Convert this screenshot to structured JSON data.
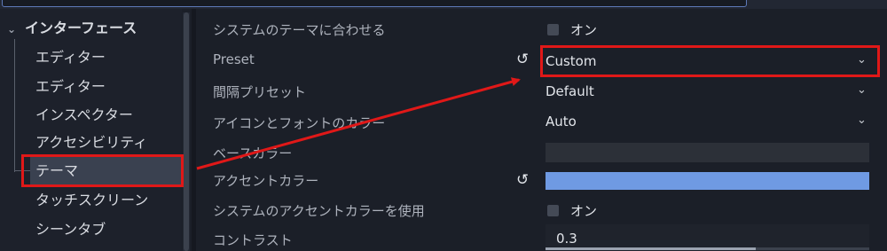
{
  "tree": {
    "root_label": "インターフェース",
    "items": [
      {
        "label": "エディター"
      },
      {
        "label": "エディター"
      },
      {
        "label": "インスペクター"
      },
      {
        "label": "アクセシビリティ"
      },
      {
        "label": "テーマ",
        "selected": true
      },
      {
        "label": "タッチスクリーン"
      },
      {
        "label": "シーンタブ"
      }
    ]
  },
  "inspector": {
    "follow_system_theme": {
      "label": "システムのテーマに合わせる",
      "value": "オン"
    },
    "preset": {
      "label": "Preset",
      "value": "Custom"
    },
    "spacing_preset": {
      "label": "間隔プリセット",
      "value": "Default"
    },
    "icon_font_color": {
      "label": "アイコンとフォントのカラー",
      "value": "Auto"
    },
    "base_color": {
      "label": "ベースカラー",
      "color": "#2c3038"
    },
    "accent_color": {
      "label": "アクセントカラー",
      "color": "#6f9ae3"
    },
    "use_system_accent": {
      "label": "システムのアクセントカラーを使用",
      "value": "オン"
    },
    "contrast": {
      "label": "コントラスト",
      "value": "0.3",
      "level": 0.65
    }
  },
  "icons": {
    "revert": "revert-icon",
    "dropdown": "chevron-down-icon",
    "tree_expand": "chevron-down-icon"
  },
  "colors": {
    "annotation": "#e01818",
    "accent": "#6f9ae3",
    "selection": "#3a4150"
  }
}
